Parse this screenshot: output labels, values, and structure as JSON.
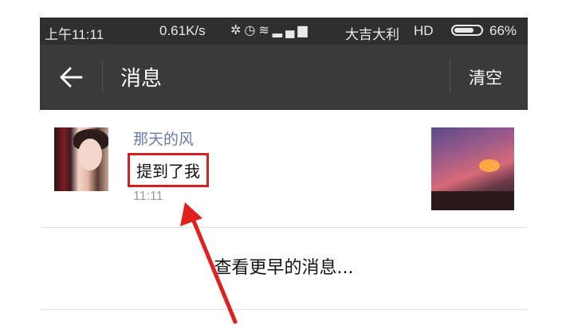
{
  "status_bar": {
    "time": "上午11:11",
    "net_speed": "0.61K/s",
    "icons": [
      "bluetooth-off-icon",
      "alarm-icon",
      "wifi-icon",
      "signal-icon"
    ],
    "carrier": "大吉大利",
    "network_type": "HD",
    "battery_percent": "66%"
  },
  "title_bar": {
    "back_icon": "back-arrow-icon",
    "title": "消息",
    "clear_label": "清空"
  },
  "messages": [
    {
      "sender": "那天的风",
      "text": "提到了我",
      "time": "11:11"
    }
  ],
  "load_more_label": "查看更早的消息...",
  "colors": {
    "status_bar_bg": "#2f2f2f",
    "title_bar_bg": "#3a3a3a",
    "sender_name": "#6a7ab0",
    "highlight_box": "#d62020",
    "annotation_arrow": "#e02020"
  }
}
